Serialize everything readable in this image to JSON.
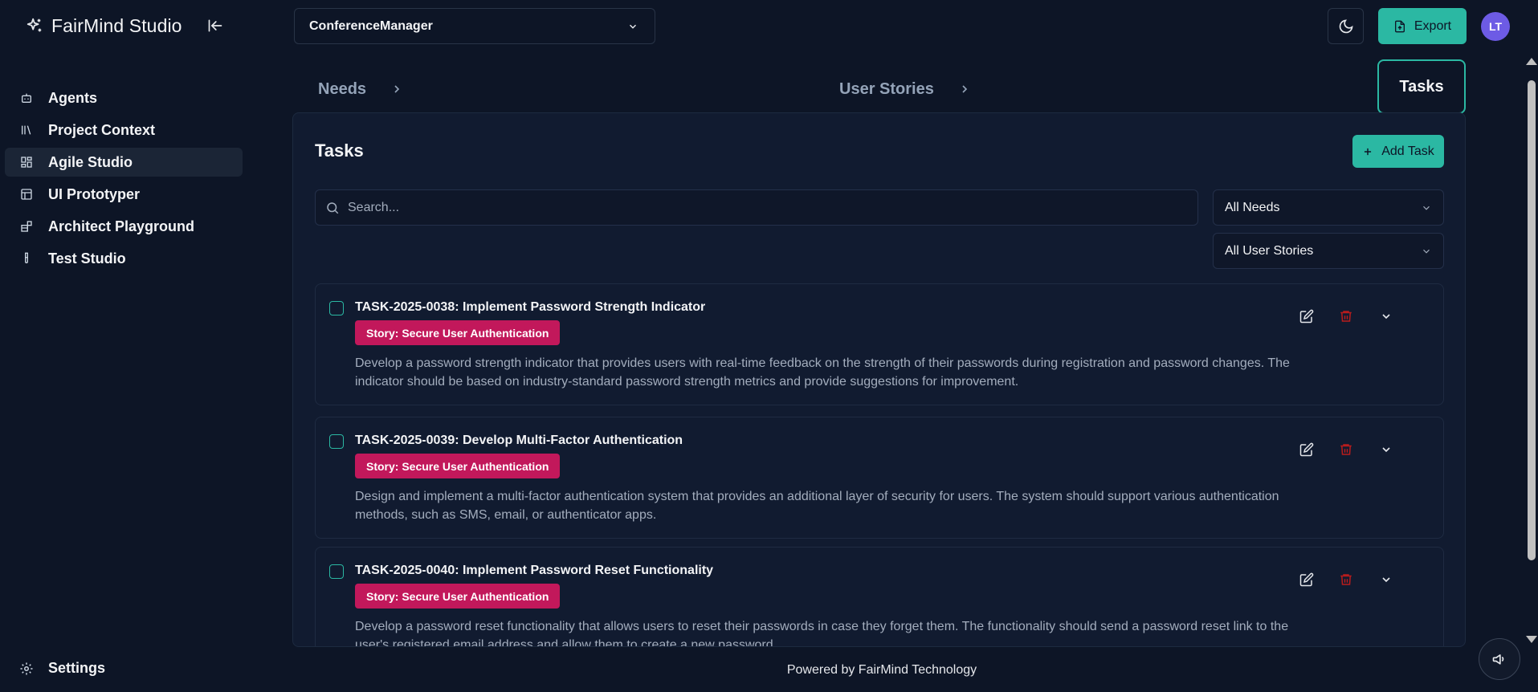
{
  "app": {
    "name": "FairMind Studio"
  },
  "sidebar": {
    "items": [
      {
        "label": "Agents",
        "icon": "bot-icon",
        "active": false
      },
      {
        "label": "Project Context",
        "icon": "library-icon",
        "active": false
      },
      {
        "label": "Agile Studio",
        "icon": "grid-icon",
        "active": true
      },
      {
        "label": "UI Prototyper",
        "icon": "layout-icon",
        "active": false
      },
      {
        "label": "Architect Playground",
        "icon": "blocks-icon",
        "active": false
      },
      {
        "label": "Test Studio",
        "icon": "test-tube-icon",
        "active": false
      }
    ],
    "settings_label": "Settings"
  },
  "header": {
    "project": "ConferenceManager",
    "export_label": "Export",
    "avatar_initials": "LT"
  },
  "stepper": {
    "steps": [
      {
        "label": "Needs"
      },
      {
        "label": "User Stories"
      },
      {
        "label": "Tasks",
        "active": true
      }
    ]
  },
  "panel": {
    "title": "Tasks",
    "add_label": "Add Task",
    "search_placeholder": "Search...",
    "filter_needs": "All Needs",
    "filter_stories": "All User Stories"
  },
  "tasks": [
    {
      "title": "TASK-2025-0038: Implement Password Strength Indicator",
      "story": "Story: Secure User Authentication",
      "description": "Develop a password strength indicator that provides users with real-time feedback on the strength of their passwords during registration and password changes. The indicator should be based on industry-standard password strength metrics and provide suggestions for improvement."
    },
    {
      "title": "TASK-2025-0039: Develop Multi-Factor Authentication",
      "story": "Story: Secure User Authentication",
      "description": "Design and implement a multi-factor authentication system that provides an additional layer of security for users. The system should support various authentication methods, such as SMS, email, or authenticator apps."
    },
    {
      "title": "TASK-2025-0040: Implement Password Reset Functionality",
      "story": "Story: Secure User Authentication",
      "description": "Develop a password reset functionality that allows users to reset their passwords in case they forget them. The functionality should send a password reset link to the user's registered email address and allow them to create a new password."
    }
  ],
  "footer": {
    "text": "Powered by FairMind Technology"
  },
  "colors": {
    "accent": "#2bb8a3",
    "badge": "#c2185b",
    "background": "#0d1526",
    "panel": "#111b30",
    "delete": "#b91c1c",
    "avatar": "#6d5be5"
  }
}
